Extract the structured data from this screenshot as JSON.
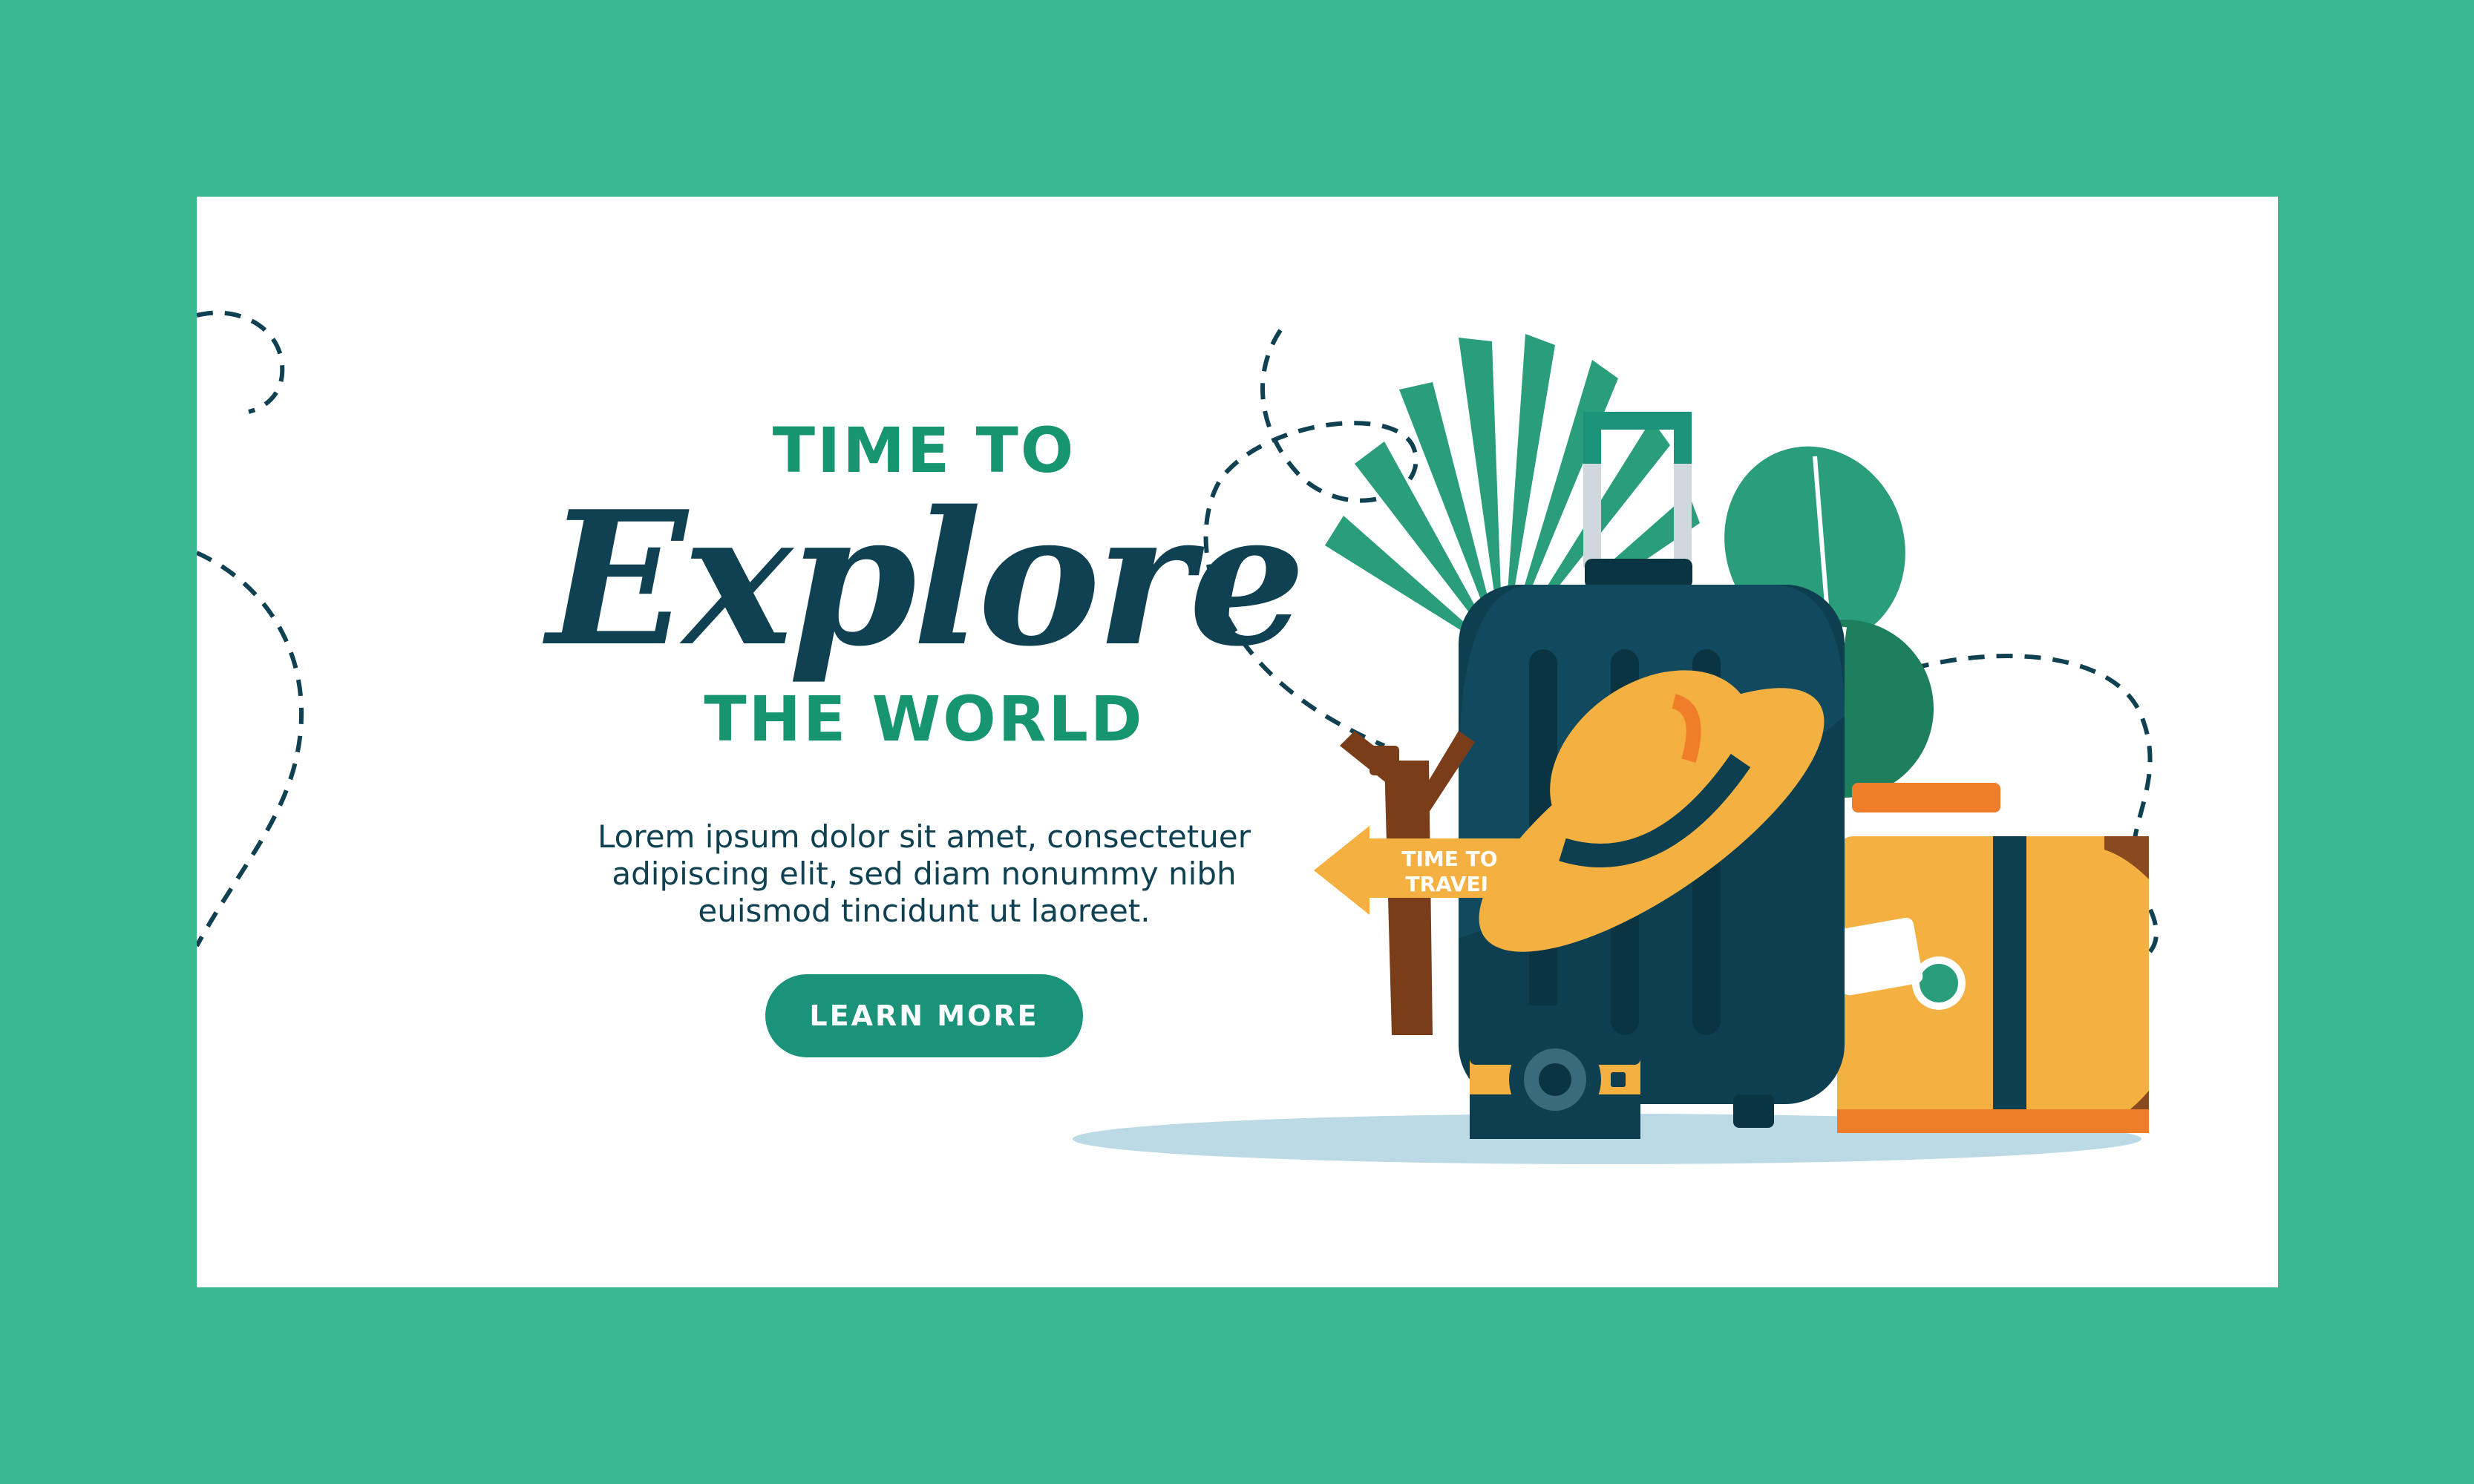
{
  "banner": {
    "kicker_top": "TIME TO",
    "headline": "Explore",
    "kicker_bottom": "THE WORLD",
    "body_lines": [
      "Lorem ipsum dolor sit amet, consectetuer",
      "adipiscing elit, sed diam nonummy nibh",
      "euismod tincidunt ut laoreet."
    ],
    "cta_label": "LEARN MORE"
  },
  "signpost": {
    "line1": "TIME TO",
    "line2": "TRAVEL"
  },
  "colors": {
    "frame": "#39b78f",
    "card": "#ffffff",
    "accent_green": "#16956f",
    "dark_teal": "#0f4152",
    "button": "#1a937a",
    "suitcase_orange": "#f5b042",
    "luggage_navy": "#0e3f50"
  },
  "icons": [
    "palm-leaf-icon",
    "monstera-leaf-icon",
    "hat-icon",
    "signpost-icon",
    "camera-icon",
    "luggage-icon",
    "suitcase-icon"
  ]
}
